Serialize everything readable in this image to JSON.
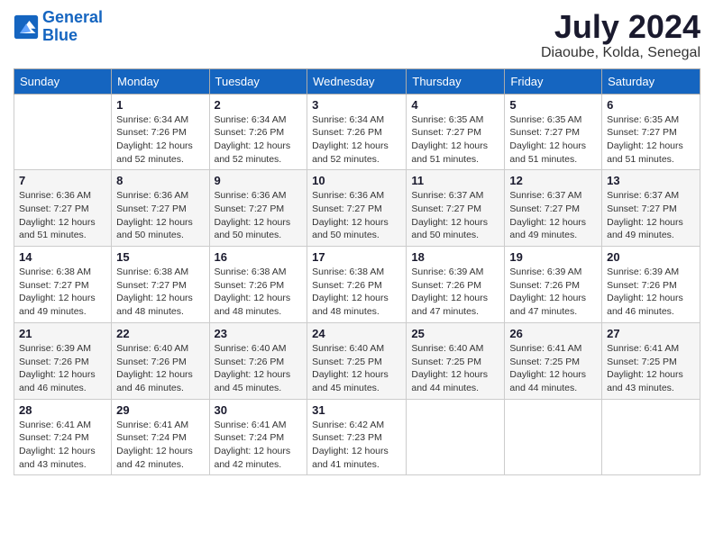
{
  "logo": {
    "line1": "General",
    "line2": "Blue"
  },
  "title": "July 2024",
  "location": "Diaoube, Kolda, Senegal",
  "weekdays": [
    "Sunday",
    "Monday",
    "Tuesday",
    "Wednesday",
    "Thursday",
    "Friday",
    "Saturday"
  ],
  "weeks": [
    [
      {
        "day": "",
        "info": ""
      },
      {
        "day": "1",
        "info": "Sunrise: 6:34 AM\nSunset: 7:26 PM\nDaylight: 12 hours\nand 52 minutes."
      },
      {
        "day": "2",
        "info": "Sunrise: 6:34 AM\nSunset: 7:26 PM\nDaylight: 12 hours\nand 52 minutes."
      },
      {
        "day": "3",
        "info": "Sunrise: 6:34 AM\nSunset: 7:26 PM\nDaylight: 12 hours\nand 52 minutes."
      },
      {
        "day": "4",
        "info": "Sunrise: 6:35 AM\nSunset: 7:27 PM\nDaylight: 12 hours\nand 51 minutes."
      },
      {
        "day": "5",
        "info": "Sunrise: 6:35 AM\nSunset: 7:27 PM\nDaylight: 12 hours\nand 51 minutes."
      },
      {
        "day": "6",
        "info": "Sunrise: 6:35 AM\nSunset: 7:27 PM\nDaylight: 12 hours\nand 51 minutes."
      }
    ],
    [
      {
        "day": "7",
        "info": "Sunrise: 6:36 AM\nSunset: 7:27 PM\nDaylight: 12 hours\nand 51 minutes."
      },
      {
        "day": "8",
        "info": "Sunrise: 6:36 AM\nSunset: 7:27 PM\nDaylight: 12 hours\nand 50 minutes."
      },
      {
        "day": "9",
        "info": "Sunrise: 6:36 AM\nSunset: 7:27 PM\nDaylight: 12 hours\nand 50 minutes."
      },
      {
        "day": "10",
        "info": "Sunrise: 6:36 AM\nSunset: 7:27 PM\nDaylight: 12 hours\nand 50 minutes."
      },
      {
        "day": "11",
        "info": "Sunrise: 6:37 AM\nSunset: 7:27 PM\nDaylight: 12 hours\nand 50 minutes."
      },
      {
        "day": "12",
        "info": "Sunrise: 6:37 AM\nSunset: 7:27 PM\nDaylight: 12 hours\nand 49 minutes."
      },
      {
        "day": "13",
        "info": "Sunrise: 6:37 AM\nSunset: 7:27 PM\nDaylight: 12 hours\nand 49 minutes."
      }
    ],
    [
      {
        "day": "14",
        "info": "Sunrise: 6:38 AM\nSunset: 7:27 PM\nDaylight: 12 hours\nand 49 minutes."
      },
      {
        "day": "15",
        "info": "Sunrise: 6:38 AM\nSunset: 7:27 PM\nDaylight: 12 hours\nand 48 minutes."
      },
      {
        "day": "16",
        "info": "Sunrise: 6:38 AM\nSunset: 7:26 PM\nDaylight: 12 hours\nand 48 minutes."
      },
      {
        "day": "17",
        "info": "Sunrise: 6:38 AM\nSunset: 7:26 PM\nDaylight: 12 hours\nand 48 minutes."
      },
      {
        "day": "18",
        "info": "Sunrise: 6:39 AM\nSunset: 7:26 PM\nDaylight: 12 hours\nand 47 minutes."
      },
      {
        "day": "19",
        "info": "Sunrise: 6:39 AM\nSunset: 7:26 PM\nDaylight: 12 hours\nand 47 minutes."
      },
      {
        "day": "20",
        "info": "Sunrise: 6:39 AM\nSunset: 7:26 PM\nDaylight: 12 hours\nand 46 minutes."
      }
    ],
    [
      {
        "day": "21",
        "info": "Sunrise: 6:39 AM\nSunset: 7:26 PM\nDaylight: 12 hours\nand 46 minutes."
      },
      {
        "day": "22",
        "info": "Sunrise: 6:40 AM\nSunset: 7:26 PM\nDaylight: 12 hours\nand 46 minutes."
      },
      {
        "day": "23",
        "info": "Sunrise: 6:40 AM\nSunset: 7:26 PM\nDaylight: 12 hours\nand 45 minutes."
      },
      {
        "day": "24",
        "info": "Sunrise: 6:40 AM\nSunset: 7:25 PM\nDaylight: 12 hours\nand 45 minutes."
      },
      {
        "day": "25",
        "info": "Sunrise: 6:40 AM\nSunset: 7:25 PM\nDaylight: 12 hours\nand 44 minutes."
      },
      {
        "day": "26",
        "info": "Sunrise: 6:41 AM\nSunset: 7:25 PM\nDaylight: 12 hours\nand 44 minutes."
      },
      {
        "day": "27",
        "info": "Sunrise: 6:41 AM\nSunset: 7:25 PM\nDaylight: 12 hours\nand 43 minutes."
      }
    ],
    [
      {
        "day": "28",
        "info": "Sunrise: 6:41 AM\nSunset: 7:24 PM\nDaylight: 12 hours\nand 43 minutes."
      },
      {
        "day": "29",
        "info": "Sunrise: 6:41 AM\nSunset: 7:24 PM\nDaylight: 12 hours\nand 42 minutes."
      },
      {
        "day": "30",
        "info": "Sunrise: 6:41 AM\nSunset: 7:24 PM\nDaylight: 12 hours\nand 42 minutes."
      },
      {
        "day": "31",
        "info": "Sunrise: 6:42 AM\nSunset: 7:23 PM\nDaylight: 12 hours\nand 41 minutes."
      },
      {
        "day": "",
        "info": ""
      },
      {
        "day": "",
        "info": ""
      },
      {
        "day": "",
        "info": ""
      }
    ]
  ]
}
